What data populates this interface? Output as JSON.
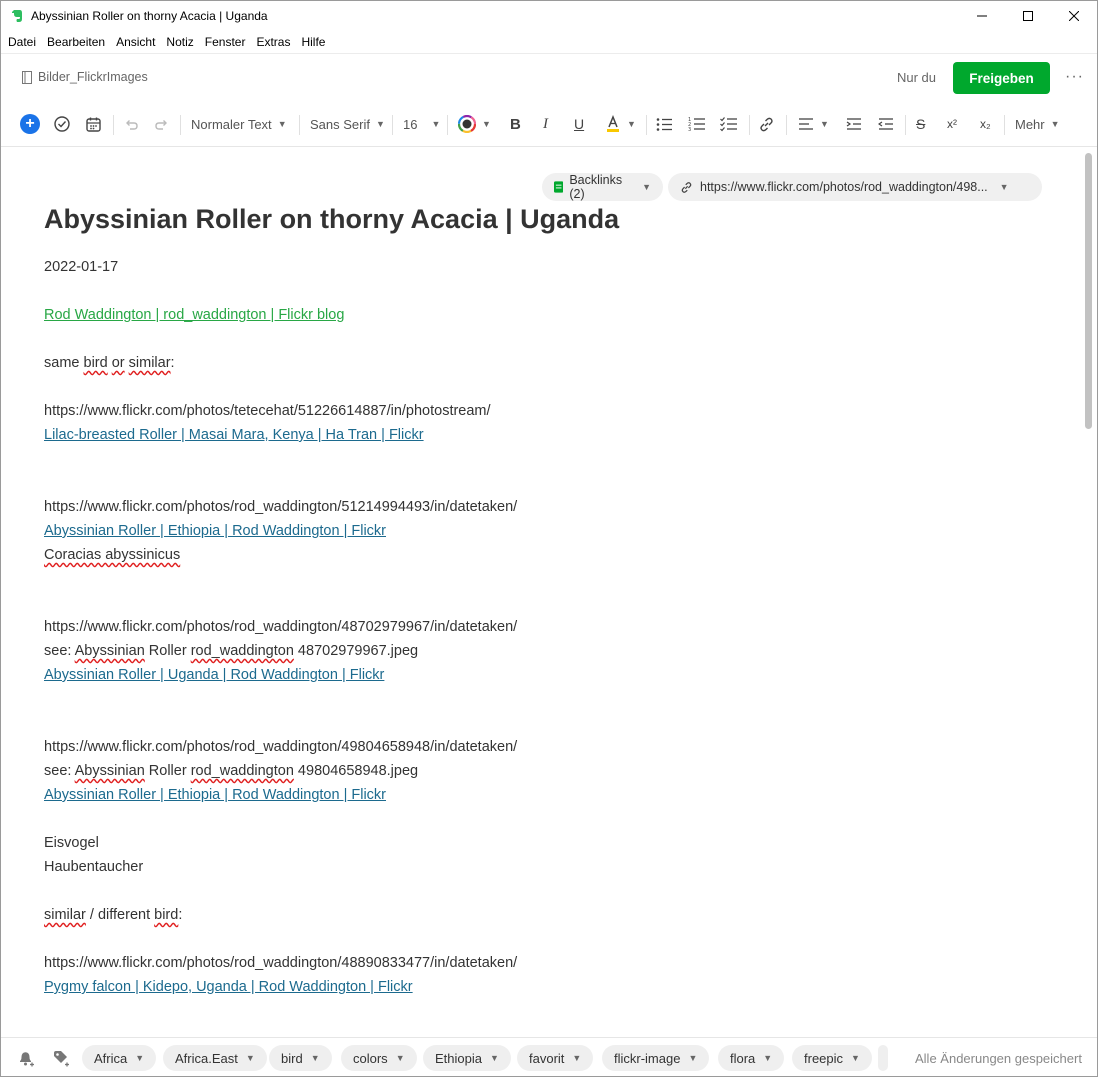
{
  "window": {
    "title": "Abyssinian Roller on thorny Acacia | Uganda",
    "controls": {
      "minimize": "—",
      "maximize": "☐",
      "close": "✕"
    },
    "icon": "evernote-elephant-icon"
  },
  "menu": [
    "Datei",
    "Bearbeiten",
    "Ansicht",
    "Notiz",
    "Fenster",
    "Extras",
    "Hilfe"
  ],
  "header": {
    "notebook": "Bilder_FlickrImages",
    "visibility": "Nur du",
    "share_label": "Freigeben",
    "more": "···"
  },
  "toolbar": {
    "insert": "+",
    "paragraph_style": "Normaler Text",
    "font_family": "Sans Serif",
    "font_size": "16",
    "bold": "B",
    "italic": "I",
    "underline": "U",
    "strikethrough": "S",
    "superscript": "x²",
    "subscript": "x₂",
    "more_label": "Mehr"
  },
  "note": {
    "backlinks": "Backlinks (2)",
    "source_url": "https://www.flickr.com/photos/rod_waddington/498...",
    "title": "Abyssinian Roller on thorny Acacia | Uganda",
    "date": "2022-01-17",
    "author_link": "Rod Waddington | rod_waddington | Flickr blog",
    "same_bird_prefix": "same ",
    "same_bird_word": "bird",
    "same_bird_mid": " ",
    "same_bird_or": "or",
    "same_bird_space": " ",
    "same_bird_similar": "similar",
    "same_bird_colon": ":",
    "url1": "https://www.flickr.com/photos/tetecehat/51226614887/in/photostream/",
    "link1": "Lilac-breasted Roller | Masai Mara, Kenya | Ha Tran | Flickr",
    "url2": "https://www.flickr.com/photos/rod_waddington/51214994493/in/datetaken/",
    "link2": "Abyssinian Roller | Ethiopia | Rod Waddington | Flickr",
    "species": "Coracias abyssinicus",
    "url3": "https://www.flickr.com/photos/rod_waddington/48702979967/in/datetaken/",
    "see3_prefix": "see:  ",
    "see3_word": "Abyssinian",
    "see3_mid": " Roller ",
    "see3_user": "rod_waddington",
    "see3_file": " 48702979967.jpeg",
    "link3": "Abyssinian Roller | Uganda | Rod Waddington | Flickr",
    "url4": "https://www.flickr.com/photos/rod_waddington/49804658948/in/datetaken/",
    "see4_prefix": "see:  ",
    "see4_word": "Abyssinian",
    "see4_mid": " Roller ",
    "see4_user": "rod_waddington",
    "see4_file": " 49804658948.jpeg",
    "link4": "Abyssinian Roller | Ethiopia | Rod Waddington | Flickr",
    "word1": "Eisvogel",
    "word2": "Haubentaucher",
    "similar_word": "similar",
    "similar_mid": " / different ",
    "similar_bird": "bird",
    "similar_colon": ":",
    "url5": "https://www.flickr.com/photos/rod_waddington/48890833477/in/datetaken/",
    "link5": "Pygmy falcon | Kidepo, Uganda | Rod Waddington | Flickr"
  },
  "tags": [
    "Africa",
    "Africa.East",
    "bird",
    "colors",
    "Ethiopia",
    "favorit",
    "flickr-image",
    "flora",
    "freepic"
  ],
  "status": "Alle Änderungen gespeichert",
  "colors": {
    "accent_green": "#00a82d",
    "link_blue": "#1c6a8e",
    "link_green": "#28a745",
    "insert_blue": "#1a73e8"
  }
}
